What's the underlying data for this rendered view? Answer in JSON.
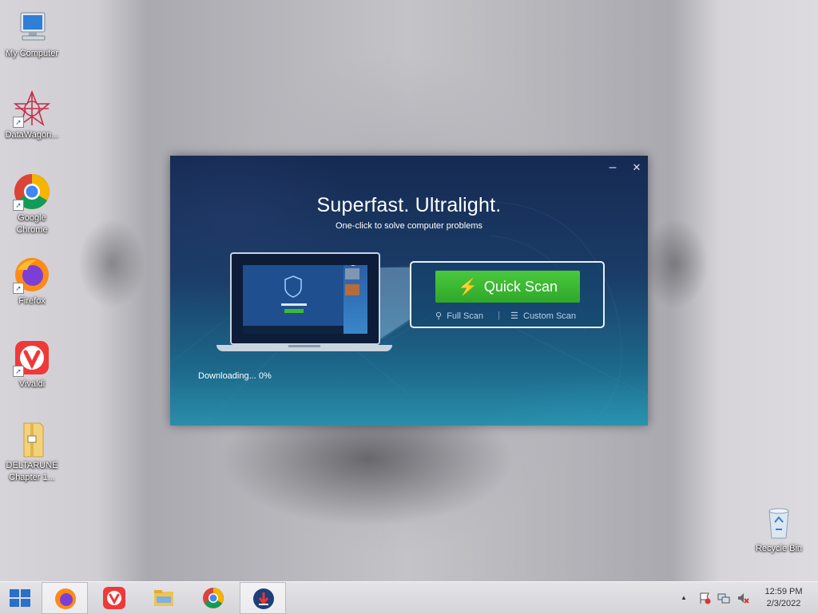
{
  "desktop": {
    "icons": [
      {
        "label": "My Computer"
      },
      {
        "label": "DataWagon..."
      },
      {
        "label": "Google Chrome"
      },
      {
        "label": "Firefox"
      },
      {
        "label": "Vivaldi"
      },
      {
        "label": "DELTARUNE Chapter 1..."
      },
      {
        "label": "Recycle Bin"
      }
    ]
  },
  "app": {
    "minimize_glyph": "–",
    "close_glyph": "✕",
    "headline": "Superfast. Ultralight.",
    "subline": "One-click to solve computer problems",
    "quick_scan_label": "Quick Scan",
    "full_scan_label": "Full Scan",
    "custom_scan_label": "Custom Scan",
    "status": "Downloading...  0%",
    "progress_percent": 0,
    "accent_green": "#3db934"
  },
  "taskbar": {
    "clock_time": "12:59 PM",
    "clock_date": "2/3/2022",
    "tray_chevron": "▲"
  }
}
